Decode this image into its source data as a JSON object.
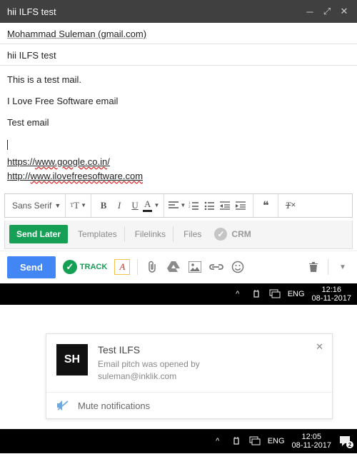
{
  "window": {
    "title": "hii ILFS test"
  },
  "compose": {
    "recipient": "Mohammad Suleman (gmail.com)",
    "subject": "hii ILFS test",
    "body": {
      "p1": "This is a test mail.",
      "p2": "I Love Free Software email",
      "p3": "Test email",
      "link1_pre": "https://",
      "link1_mid": "www.google.co.in",
      "link1_post": "/",
      "link2_pre": "http://",
      "link2_mid": "www.ilovefreesoftware.com",
      "link2_post": ""
    }
  },
  "format": {
    "font": "Sans Serif"
  },
  "actions": {
    "send_later": "Send Later",
    "templates": "Templates",
    "filelinks": "Filelinks",
    "files": "Files",
    "crm": "CRM",
    "send": "Send",
    "track": "TRACK"
  },
  "taskbar1": {
    "lang": "ENG",
    "time": "12:16",
    "date": "08-11-2017"
  },
  "notification": {
    "logo": "SH",
    "title": "Test ILFS",
    "line1": "Email pitch was opened by",
    "line2": "suleman@inklik.com",
    "mute": "Mute notifications"
  },
  "taskbar2": {
    "lang": "ENG",
    "time": "12:05",
    "date": "08-11-2017",
    "count": "2"
  }
}
